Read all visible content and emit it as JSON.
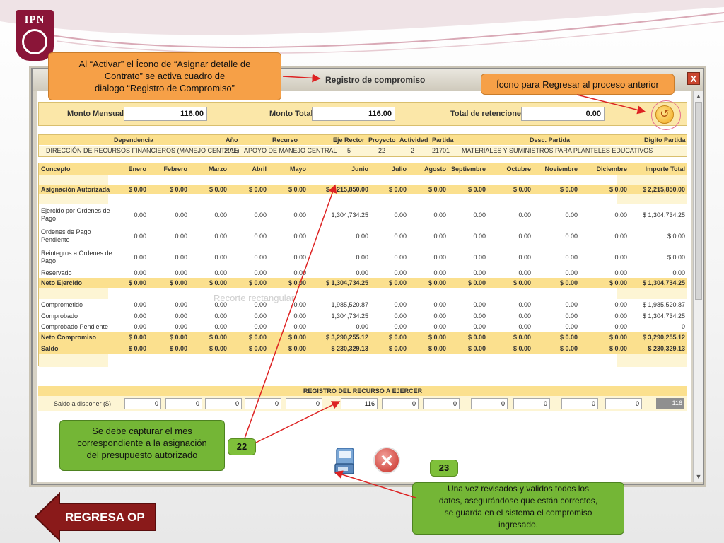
{
  "logo": {
    "text": "IPN"
  },
  "callouts": {
    "activar": "Al “Activar” el Ícono de “Asignar detalle de Contrato” se activa cuadro de dialogo “Registro de Compromiso”",
    "activar_lines": [
      "Al “Activar” el Ícono de “Asignar detalle de",
      "Contrato” se activa cuadro de",
      "dialogo “Registro de Compromiso”"
    ],
    "regresar": "Ícono para Regresar al proceso anterior",
    "capturar_lines": [
      "Se debe capturar el mes",
      "correspondiente a la asignación",
      "del presupuesto autorizado"
    ],
    "guardar_lines": [
      "Una vez revisados y validos todos los",
      "datos, asegurándose que están correctos,",
      "se guarda en el sistema el compromiso",
      "ingresado."
    ],
    "badge_22": "22",
    "badge_23": "23"
  },
  "dialog": {
    "title": "Registro de compromiso",
    "close": "X",
    "ghost_text": "Recorte rectangular",
    "montos": {
      "mensual_label": "Monto Mensual:",
      "mensual_value": "116.00",
      "total_label": "Monto Total:",
      "total_value": "116.00",
      "retenciones_label": "Total de retenciones:",
      "retenciones_value": "0.00"
    },
    "dependencia": {
      "headers": [
        "Dependencia",
        "Año",
        "Recurso",
        "Eje Rector",
        "Proyecto",
        "Actividad",
        "Partida",
        "Desc. Partida",
        "Digito Partida"
      ],
      "values": [
        "DIRECCIÓN DE RECURSOS FINANCIEROS (MANEJO CENTRAL)",
        "2015",
        "APOYO DE MANEJO CENTRAL",
        "5",
        "22",
        "2",
        "21701",
        "MATERIALES Y SUMINISTROS PARA PLANTELES EDUCATIVOS",
        ""
      ]
    },
    "grid": {
      "headers": [
        "Concepto",
        "Enero",
        "Febrero",
        "Marzo",
        "Abril",
        "Mayo",
        "Junio",
        "Julio",
        "Agosto",
        "Septiembre",
        "Octubre",
        "Noviembre",
        "Diciembre",
        "Importe Total"
      ],
      "rows": [
        {
          "lines": [
            "Asignación Autorizada"
          ],
          "values": [
            "$ 0.00",
            "$ 0.00",
            "$ 0.00",
            "$ 0.00",
            "$ 0.00",
            "$ 2,215,850.00",
            "$ 0.00",
            "$ 0.00",
            "$ 0.00",
            "$ 0.00",
            "$ 0.00",
            "$ 0.00",
            "$ 2,215,850.00"
          ]
        },
        {
          "lines": [
            "Ejercido por Ordenes de",
            "Pago"
          ],
          "values": [
            "0.00",
            "0.00",
            "0.00",
            "0.00",
            "0.00",
            "1,304,734.25",
            "0.00",
            "0.00",
            "0.00",
            "0.00",
            "0.00",
            "0.00",
            "$ 1,304,734.25"
          ]
        },
        {
          "lines": [
            "Ordenes de Pago",
            "Pendiente"
          ],
          "values": [
            "0.00",
            "0.00",
            "0.00",
            "0.00",
            "0.00",
            "0.00",
            "0.00",
            "0.00",
            "0.00",
            "0.00",
            "0.00",
            "0.00",
            "$ 0.00"
          ]
        },
        {
          "lines": [
            "Reintegros a Ordenes de",
            "Pago"
          ],
          "values": [
            "0.00",
            "0.00",
            "0.00",
            "0.00",
            "0.00",
            "0.00",
            "0.00",
            "0.00",
            "0.00",
            "0.00",
            "0.00",
            "0.00",
            "$ 0.00"
          ]
        },
        {
          "lines": [
            "Reservado"
          ],
          "values": [
            "0.00",
            "0.00",
            "0.00",
            "0.00",
            "0.00",
            "0.00",
            "0.00",
            "0.00",
            "0.00",
            "0.00",
            "0.00",
            "0.00",
            "0.00"
          ]
        },
        {
          "lines": [
            "Neto Ejercido"
          ],
          "values": [
            "$ 0.00",
            "$ 0.00",
            "$ 0.00",
            "$ 0.00",
            "$ 0.00",
            "$ 1,304,734.25",
            "$ 0.00",
            "$ 0.00",
            "$ 0.00",
            "$ 0.00",
            "$ 0.00",
            "$ 0.00",
            "$ 1,304,734.25"
          ]
        },
        {
          "lines": [
            "Comprometido"
          ],
          "values": [
            "0.00",
            "0.00",
            "0.00",
            "0.00",
            "0.00",
            "1,985,520.87",
            "0.00",
            "0.00",
            "0.00",
            "0.00",
            "0.00",
            "0.00",
            "$ 1,985,520.87"
          ]
        },
        {
          "lines": [
            "Comprobado"
          ],
          "values": [
            "0.00",
            "0.00",
            "0.00",
            "0.00",
            "0.00",
            "1,304,734.25",
            "0.00",
            "0.00",
            "0.00",
            "0.00",
            "0.00",
            "0.00",
            "$ 1,304,734.25"
          ]
        },
        {
          "lines": [
            "Comprobado Pendiente"
          ],
          "values": [
            "0.00",
            "0.00",
            "0.00",
            "0.00",
            "0.00",
            "0.00",
            "0.00",
            "0.00",
            "0.00",
            "0.00",
            "0.00",
            "0.00",
            "0"
          ]
        },
        {
          "lines": [
            "Neto Compromiso"
          ],
          "values": [
            "$ 0.00",
            "$ 0.00",
            "$ 0.00",
            "$ 0.00",
            "$ 0.00",
            "$ 3,290,255.12",
            "$ 0.00",
            "$ 0.00",
            "$ 0.00",
            "$ 0.00",
            "$ 0.00",
            "$ 0.00",
            "$ 3,290,255.12"
          ]
        },
        {
          "lines": [
            "Saldo"
          ],
          "values": [
            "$ 0.00",
            "$ 0.00",
            "$ 0.00",
            "$ 0.00",
            "$ 0.00",
            "$ 230,329.13",
            "$ 0.00",
            "$ 0.00",
            "$ 0.00",
            "$ 0.00",
            "$ 0.00",
            "$ 0.00",
            "$ 230,329.13"
          ]
        }
      ]
    },
    "registro": {
      "title": "REGISTRO DEL RECURSO A EJERCER",
      "label": "Saldo a disponer ($)",
      "values": [
        "0",
        "0",
        "0",
        "0",
        "0",
        "116",
        "0",
        "0",
        "0",
        "0",
        "0",
        "0"
      ],
      "total": "116"
    },
    "icons": {
      "save": "save-icon",
      "cancel": "cancel-icon",
      "back": "back-arrow-icon"
    }
  },
  "nav": {
    "regresa": "REGRESA OP"
  },
  "colors": {
    "orange_callout": "#f6a047",
    "green_callout": "#74b636",
    "regresa_red": "#8a1a1a",
    "header_yellow": "#fbe08e"
  }
}
